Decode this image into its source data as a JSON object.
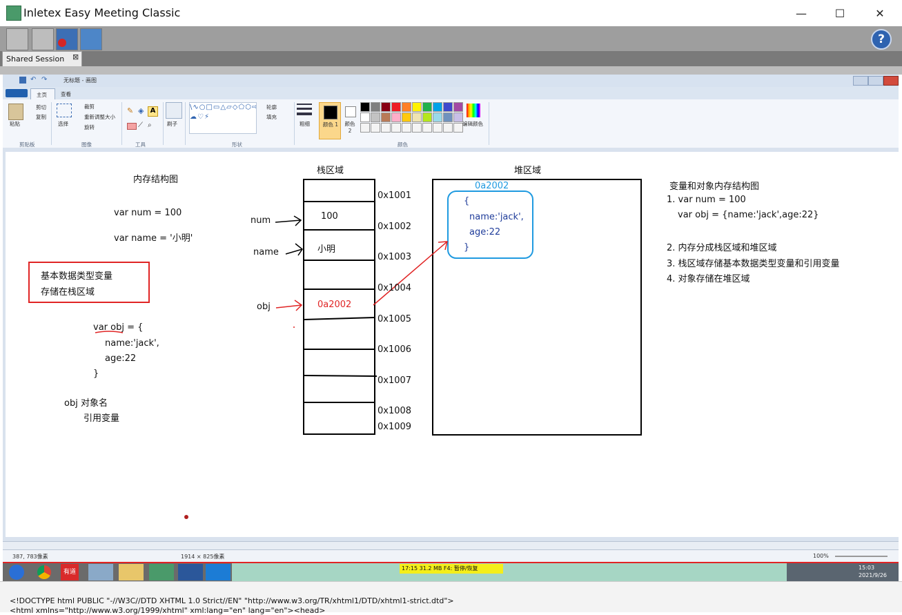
{
  "window": {
    "title": "Inletex Easy Meeting Classic",
    "minimize": "—",
    "maximize": "☐",
    "close": "✕"
  },
  "toolbar": {
    "help_label": "?"
  },
  "session_tab": {
    "label": "Shared Session",
    "close": "⊠"
  },
  "paint": {
    "title": "无标题 - 画图",
    "tabs": [
      "主页",
      "查看"
    ],
    "clipboard": {
      "paste": "粘贴",
      "cut": "剪切",
      "copy": "复制",
      "group": "剪贴板"
    },
    "image": {
      "select": "选择",
      "crop": "裁剪",
      "resize": "重新调整大小",
      "rotate": "旋转",
      "group": "图像"
    },
    "tools": {
      "group": "工具"
    },
    "brush": {
      "label": "刷子"
    },
    "shapes": {
      "outline": "轮廓",
      "fill": "填充",
      "group": "形状"
    },
    "size": {
      "label": "粗细"
    },
    "color1": {
      "label": "颜色 1"
    },
    "color2": {
      "label": "颜色 2"
    },
    "colors": {
      "edit": "编辑颜色",
      "group": "颜色"
    },
    "palette_row1": [
      "#000000",
      "#7f7f7f",
      "#880015",
      "#ed1c24",
      "#ff7f27",
      "#fff200",
      "#22b14c",
      "#00a2e8",
      "#3f48cc",
      "#a349a4"
    ],
    "palette_row2": [
      "#ffffff",
      "#c3c3c3",
      "#b97a57",
      "#ffaec9",
      "#ffc90e",
      "#efe4b0",
      "#b5e61d",
      "#99d9ea",
      "#7092be",
      "#c8bfe7"
    ]
  },
  "status": {
    "cursor": "387, 783像素",
    "size": "1914 × 825像素",
    "zoom": "100%"
  },
  "taskbar": {
    "notify": "17:15   31.2 MB   F4: 暂停/恢复",
    "time": "15:03",
    "date": "2021/9/26",
    "youdao": "有道"
  },
  "code": {
    "line1": "<!DOCTYPE html PUBLIC \"-//W3C//DTD XHTML 1.0 Strict//EN\" \"http://www.w3.org/TR/xhtml1/DTD/xhtml1-strict.dtd\">",
    "line2": "<html xmlns=\"http://www.w3.org/1999/xhtml\" xml:lang=\"en\" lang=\"en\"><head>"
  },
  "drawing": {
    "title_left": "内存结构图",
    "var_num": "var  num = 100",
    "var_name": "var name = '小明'",
    "box_line1": "基本数据类型变量",
    "box_line2": "存储在栈区域",
    "obj_l1": "var obj = {",
    "obj_l2": "name:'jack',",
    "obj_l3": "age:22",
    "obj_l4": "}",
    "obj_label": "obj  对象名",
    "ref_label": "引用变量",
    "stack_title": "栈区域",
    "heap_title": "堆区域",
    "num_label": "num",
    "name_label": "name",
    "obj_ptr_label": "obj",
    "cell_100": "100",
    "cell_xiaoming": "小明",
    "cell_addr": "0a2002",
    "addresses": [
      "0x1001",
      "0x1002",
      "0x1003",
      "0x1004",
      "0x1005",
      "0x1006",
      "0x1007",
      "0x1008",
      "0x1009"
    ],
    "heap_addr": "0a2002",
    "heap_l1": "{",
    "heap_l2": "name:'jack',",
    "heap_l3": "age:22",
    "heap_l4": "}",
    "right_title": "变量和对象内存结构图",
    "r1": "1. var num = 100",
    "r1b": "var obj = {name:'jack',age:22}",
    "r2": "2. 内存分成栈区域和堆区域",
    "r3": "3. 栈区域存储基本数据类型变量和引用变量",
    "r4": "4. 对象存储在堆区域"
  }
}
